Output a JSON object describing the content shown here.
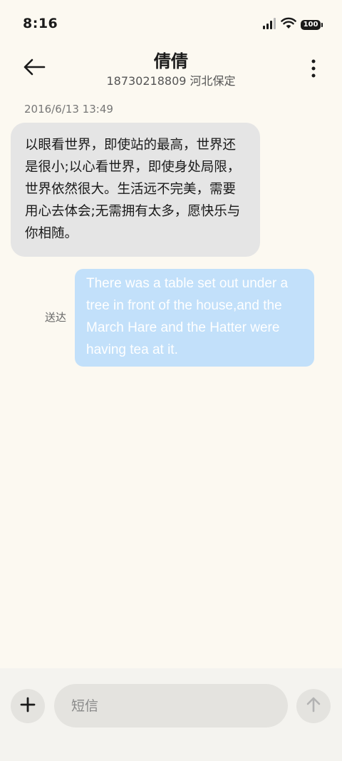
{
  "status_bar": {
    "time": "8:16",
    "battery": "100",
    "icons": [
      "signal-icon",
      "wifi-icon",
      "battery-icon"
    ]
  },
  "header": {
    "title": "倩倩",
    "subtitle": "18730218809 河北保定",
    "back_icon": "back-arrow-icon",
    "more_icon": "more-vertical-icon"
  },
  "conversation": {
    "timestamp": "2016/6/13 13:49",
    "messages": [
      {
        "direction": "incoming",
        "text": "以眼看世界，即使站的最高，世界还是很小;以心看世界，即使身处局限，世界依然很大。生活远不完美，需要用心去体会;无需拥有太多，愿快乐与你相随。"
      },
      {
        "direction": "outgoing",
        "text": "There was a table set out under a tree in front of the house,and the March Hare and the Hatter were having tea at it.",
        "status": "送达"
      }
    ]
  },
  "compose": {
    "placeholder": "短信",
    "value": "",
    "add_icon": "plus-icon",
    "send_icon": "arrow-up-icon"
  },
  "colors": {
    "background": "#fcf9f1",
    "incoming_bubble": "#e5e5e5",
    "outgoing_bubble": "#c2e0fa",
    "compose_bar": "#f4f3ef"
  }
}
